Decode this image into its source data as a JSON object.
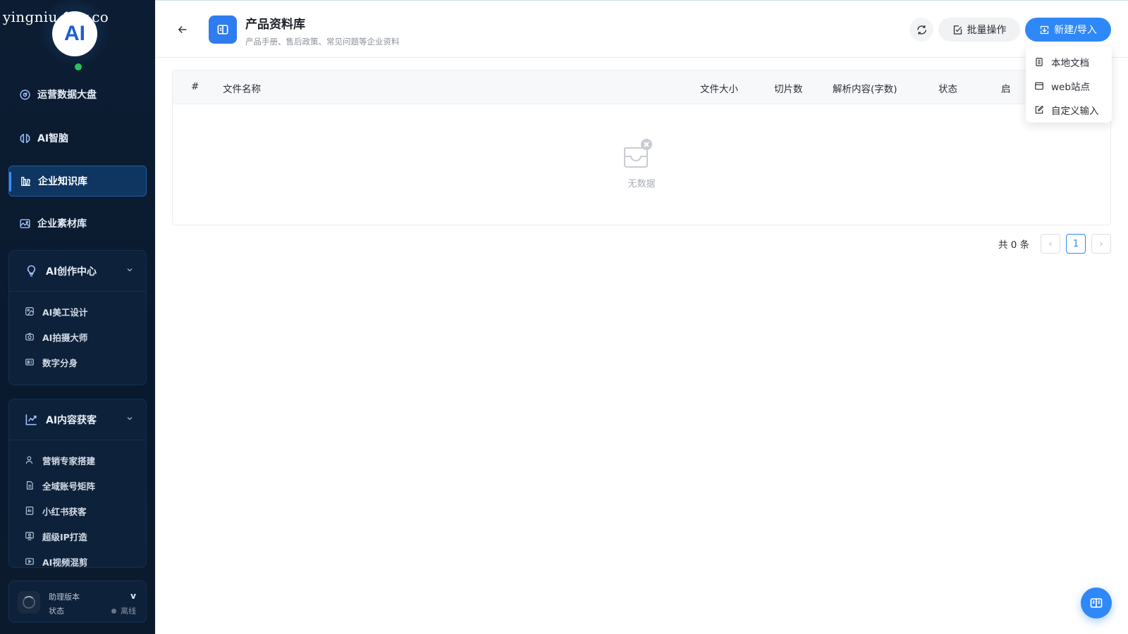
{
  "watermark": "yingniu.10v.co",
  "logo_text": "AI",
  "sidebar": {
    "nav": [
      {
        "label": "运营数据大盘",
        "icon": "dashboard-icon"
      },
      {
        "label": "AI智脑",
        "icon": "brain-icon"
      },
      {
        "label": "企业知识库",
        "icon": "library-icon",
        "active": true
      },
      {
        "label": "企业素材库",
        "icon": "image-icon"
      }
    ],
    "groups": [
      {
        "label": "AI创作中心",
        "icon": "lightbulb-icon",
        "items": [
          {
            "label": "AI美工设计",
            "icon": "palette-icon"
          },
          {
            "label": "AI拍摄大师",
            "icon": "camera-icon"
          },
          {
            "label": "数字分身",
            "icon": "id-card-icon"
          }
        ]
      },
      {
        "label": "AI内容获客",
        "icon": "trend-chart-icon",
        "items": [
          {
            "label": "营销专家搭建",
            "icon": "user-icon"
          },
          {
            "label": "全域账号矩阵",
            "icon": "document-icon"
          },
          {
            "label": "小红书获客",
            "icon": "ai-book-icon"
          },
          {
            "label": "超级IP打造",
            "icon": "monitor-user-icon"
          },
          {
            "label": "AI视频混剪",
            "icon": "video-icon"
          }
        ]
      }
    ],
    "status": {
      "version_label": "助理版本",
      "version_value": "v",
      "status_label": "状态",
      "status_value": "离线"
    }
  },
  "header": {
    "title": "产品资料库",
    "subtitle": "产品手册、售后政策、常见问题等企业资料",
    "batch_label": "批量操作",
    "new_label": "新建/导入"
  },
  "dropdown": [
    {
      "label": "本地文档",
      "icon": "local-doc-icon"
    },
    {
      "label": "web站点",
      "icon": "web-icon"
    },
    {
      "label": "自定义输入",
      "icon": "edit-icon"
    }
  ],
  "table": {
    "columns": [
      "#",
      "文件名称",
      "文件大小",
      "切片数",
      "解析内容(字数)",
      "状态",
      "启"
    ],
    "rows": [],
    "empty_text": "无数据"
  },
  "pagination": {
    "total_text": "共 0 条",
    "current_page": "1",
    "prev": "‹",
    "next": "›"
  },
  "colors": {
    "sidebar_bg": "#0b1a2d",
    "accent": "#2f88f7",
    "online": "#22c55e"
  }
}
